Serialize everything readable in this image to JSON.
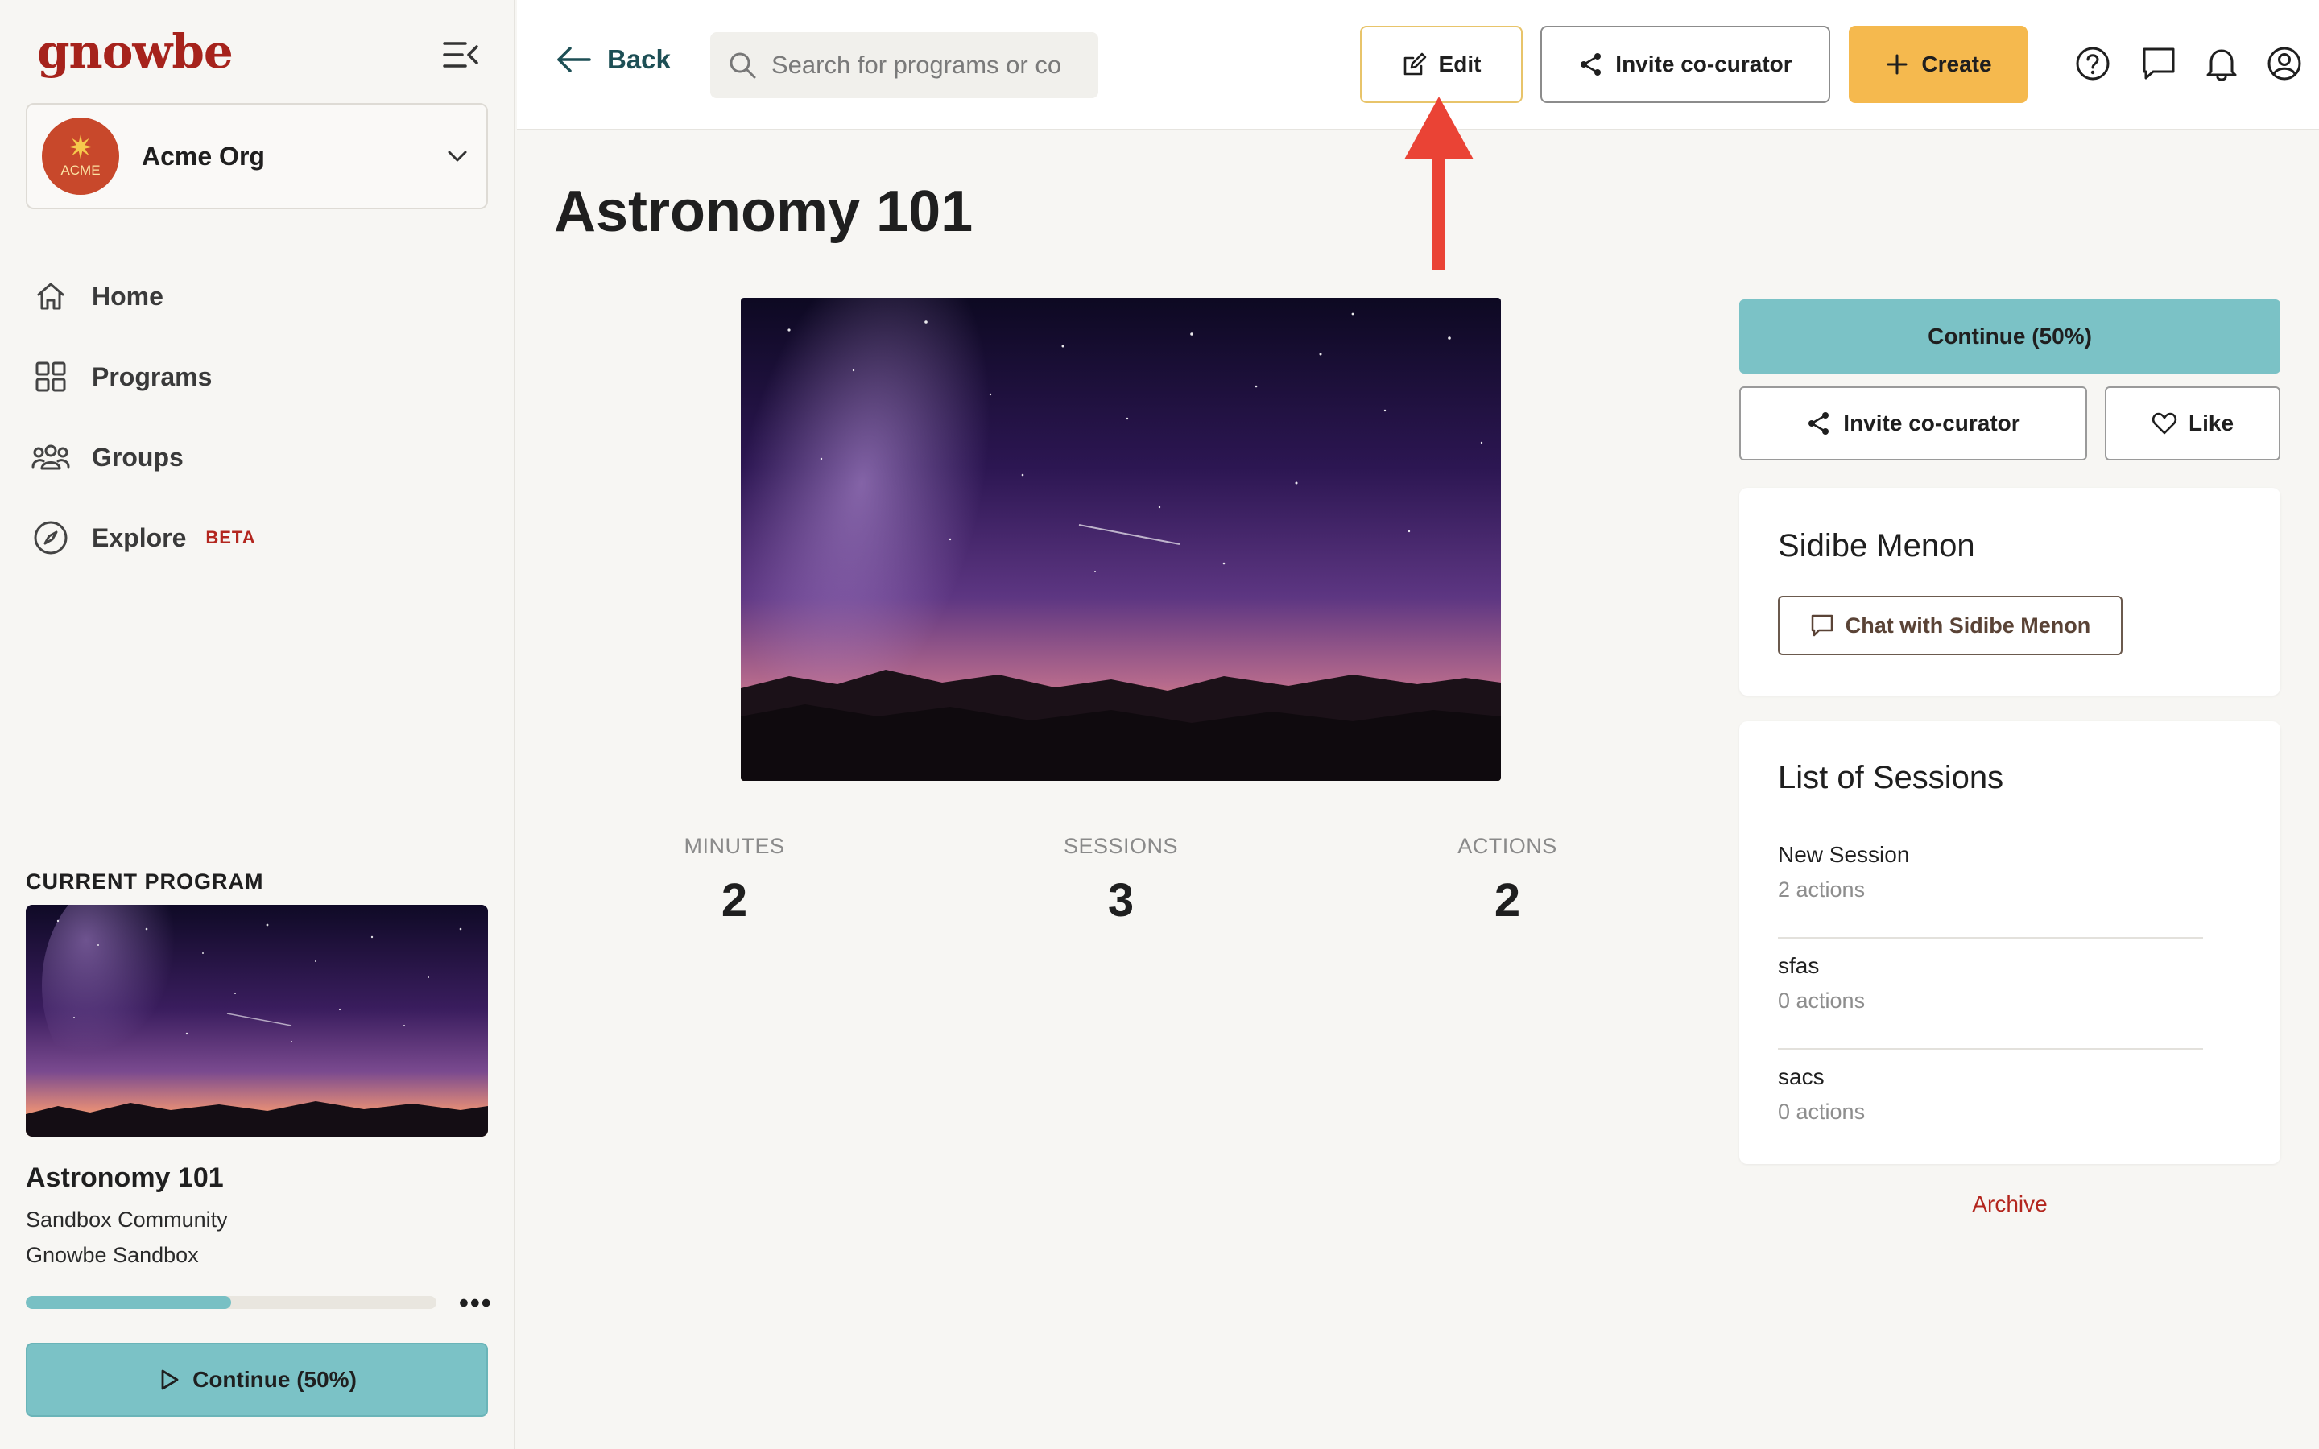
{
  "brand": {
    "logo_text": "gnowbe",
    "accent_color": "#a6231c"
  },
  "org": {
    "name": "Acme Org",
    "avatar_text": "ACME"
  },
  "nav": {
    "home": "Home",
    "programs": "Programs",
    "groups": "Groups",
    "explore": "Explore",
    "explore_badge": "BETA"
  },
  "current_program": {
    "heading": "CURRENT PROGRAM",
    "title": "Astronomy 101",
    "community": "Sandbox Community",
    "workspace": "Gnowbe Sandbox",
    "progress": 0.5,
    "continue_label": "Continue (50%)"
  },
  "topbar": {
    "back_label": "Back",
    "search_placeholder": "Search for programs or co",
    "edit_label": "Edit",
    "invite_label": "Invite co-curator",
    "create_label": "Create",
    "icons": [
      "help-icon",
      "chat-icon",
      "bell-icon",
      "profile-icon"
    ]
  },
  "program": {
    "title": "Astronomy 101",
    "stats": [
      {
        "label": "MINUTES",
        "value": "2"
      },
      {
        "label": "SESSIONS",
        "value": "3"
      },
      {
        "label": "ACTIONS",
        "value": "2"
      }
    ]
  },
  "panel": {
    "continue_label": "Continue (50%)",
    "invite_label": "Invite co-curator",
    "like_label": "Like",
    "author_name": "Sidibe Menon",
    "chat_label": "Chat with Sidibe Menon",
    "sessions_title": "List of Sessions",
    "sessions": [
      {
        "name": "New Session",
        "actions": "2 actions"
      },
      {
        "name": "sfas",
        "actions": "0 actions"
      },
      {
        "name": "sacs",
        "actions": "0 actions"
      }
    ],
    "archive_label": "Archive"
  },
  "colors": {
    "teal": "#7bc2c6",
    "create_yellow": "#f5b94e",
    "archive_red": "#b3261e",
    "annotation_arrow": "#ea4335"
  }
}
